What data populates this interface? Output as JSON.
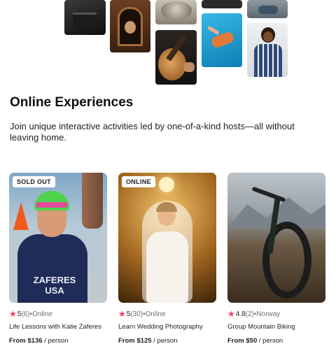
{
  "section": {
    "title": "Online Experiences",
    "subtitle": "Join unique interactive activities led by one-of-a-kind hosts—all without leaving home."
  },
  "cards": [
    {
      "badge": "SOLD OUT",
      "rating": "5",
      "reviews": "(6)",
      "location": "•Online",
      "title": "Life Lessons with Katie Zaferes",
      "price": "From $136",
      "unit": " / person",
      "photo_text": "ZAFERES USA"
    },
    {
      "badge": "ONLINE",
      "rating": "5",
      "reviews": "(30)",
      "location": "•Online",
      "title": "Learn Wedding Photography",
      "price": "From $125",
      "unit": " / person"
    },
    {
      "badge": "",
      "rating": "4.8",
      "reviews": "(2)",
      "location": "•Norway",
      "title": "Group Mountain Biking",
      "price": "From $50",
      "unit": " / person"
    }
  ],
  "icons": {
    "star": "star-icon"
  },
  "colors": {
    "star": "#ff385c",
    "text": "#222222",
    "muted": "#717171"
  }
}
